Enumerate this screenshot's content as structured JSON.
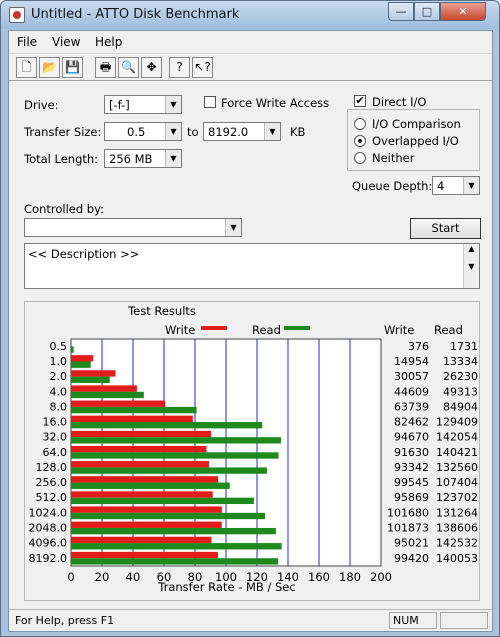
{
  "window": {
    "title": "Untitled - ATTO Disk Benchmark",
    "min": "—",
    "max": "□",
    "close": "✕"
  },
  "menu": [
    "File",
    "View",
    "Help"
  ],
  "toolbar": [
    "new-icon",
    "open-icon",
    "save-icon",
    "print-icon",
    "print-preview-icon",
    "move-icon",
    "help-icon",
    "context-help-icon"
  ],
  "settings": {
    "drive_label": "Drive:",
    "drive_value": "[-f-]",
    "force_write_label": "Force Write Access",
    "force_write_checked": false,
    "transfer_size_label": "Transfer Size:",
    "transfer_from": "0.5",
    "to_label": "to",
    "transfer_to": "8192.0",
    "kb_label": "KB",
    "total_length_label": "Total Length:",
    "total_length_value": "256 MB",
    "direct_io_label": "Direct I/O",
    "direct_io_checked": true,
    "io_comparison_label": "I/O Comparison",
    "overlapped_io_label": "Overlapped I/O",
    "neither_label": "Neither",
    "selected_io": "Overlapped I/O",
    "queue_depth_label": "Queue Depth:",
    "queue_depth_value": "4",
    "controlled_by_label": "Controlled by:",
    "controlled_by_value": "",
    "start_label": "Start",
    "description": "<< Description >>"
  },
  "chart_data": {
    "type": "bar",
    "title": "Test Results",
    "xlabel": "Transfer Rate - MB / Sec",
    "xlim": [
      0,
      200
    ],
    "x_ticks": [
      "0",
      "20",
      "40",
      "60",
      "80",
      "100",
      "120",
      "140",
      "160",
      "180",
      "200"
    ],
    "categories": [
      "0.5",
      "1.0",
      "2.0",
      "4.0",
      "8.0",
      "16.0",
      "32.0",
      "64.0",
      "128.0",
      "256.0",
      "512.0",
      "1024.0",
      "2048.0",
      "4096.0",
      "8192.0"
    ],
    "series": [
      {
        "name": "Write",
        "color": "#e21b1b",
        "values": [
          0.4,
          14.3,
          28.7,
          42.5,
          60.8,
          78.6,
          90.3,
          87.4,
          89.0,
          94.9,
          91.4,
          97.3,
          97.2,
          90.6,
          94.8
        ]
      },
      {
        "name": "Read",
        "color": "#1e8a1e",
        "values": [
          1.7,
          12.7,
          25.0,
          47.0,
          81.0,
          123.4,
          135.5,
          133.9,
          126.4,
          102.4,
          118.0,
          125.2,
          132.2,
          135.9,
          133.6
        ]
      }
    ],
    "table": {
      "write_header": "Write",
      "read_header": "Read",
      "write": [
        "376",
        "14954",
        "30057",
        "44609",
        "63739",
        "82462",
        "94670",
        "91630",
        "93342",
        "99545",
        "95869",
        "101680",
        "101873",
        "95021",
        "99420"
      ],
      "read": [
        "1731",
        "13334",
        "26230",
        "49313",
        "84904",
        "129409",
        "142054",
        "140421",
        "132560",
        "107404",
        "123702",
        "131264",
        "138606",
        "142532",
        "140053"
      ]
    },
    "grid": true,
    "legend": "top"
  },
  "status": {
    "help_text": "For Help, press F1",
    "num": "NUM"
  }
}
